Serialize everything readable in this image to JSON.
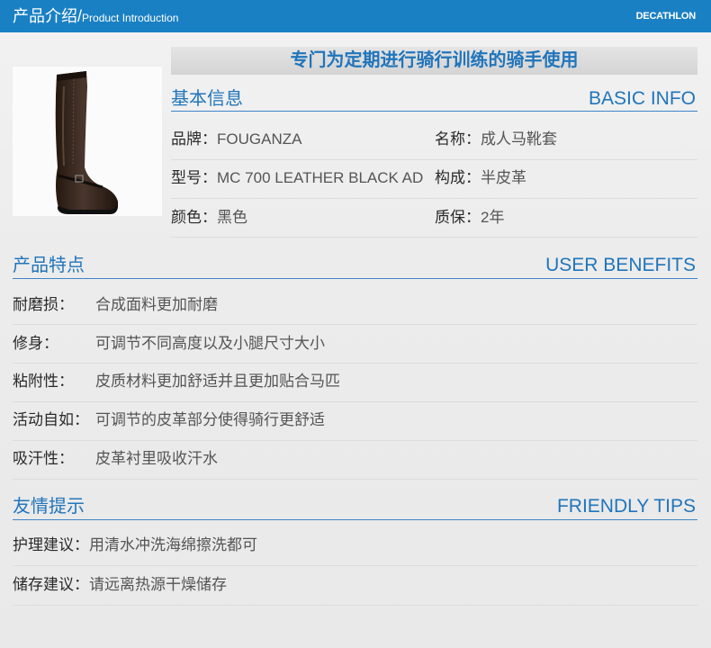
{
  "header": {
    "title_cn": "产品介绍/",
    "title_en": "Product Introduction",
    "brand": "DECATHLON"
  },
  "product_image": {
    "icon": "riding-boot-icon"
  },
  "banner": {
    "text": "专门为定期进行骑行训练的骑手使用"
  },
  "basic_info": {
    "title_cn": "基本信息",
    "title_en": "BASIC INFO",
    "fields": [
      {
        "label": "品牌：",
        "value": "FOUGANZA"
      },
      {
        "label": "名称：",
        "value": "成人马靴套"
      },
      {
        "label": "型号：",
        "value": "MC 700 LEATHER BLACK AD"
      },
      {
        "label": "构成：",
        "value": "半皮革"
      },
      {
        "label": "颜色：",
        "value": "黑色"
      },
      {
        "label": "质保：",
        "value": "2年"
      }
    ]
  },
  "user_benefits": {
    "title_cn": "产品特点",
    "title_en": "USER BENEFITS",
    "items": [
      {
        "label": "耐磨损：",
        "value": "合成面料更加耐磨"
      },
      {
        "label": "修身：",
        "value": "可调节不同高度以及小腿尺寸大小"
      },
      {
        "label": "粘附性：",
        "value": "皮质材料更加舒适并且更加贴合马匹"
      },
      {
        "label": "活动自如：",
        "value": "可调节的皮革部分使得骑行更舒适"
      },
      {
        "label": "吸汗性：",
        "value": "皮革衬里吸收汗水"
      }
    ]
  },
  "friendly_tips": {
    "title_cn": "友情提示",
    "title_en": "FRIENDLY TIPS",
    "items": [
      {
        "label": "护理建议：",
        "value": "用清水冲洗海绵擦洗都可"
      },
      {
        "label": "储存建议：",
        "value": "请远离热源干燥储存"
      }
    ]
  },
  "colors": {
    "header_bg": "#1a80c4",
    "heading_blue": "#2175bb",
    "banner_bg": "#dcdcdc",
    "page_bg": "#ececec"
  }
}
